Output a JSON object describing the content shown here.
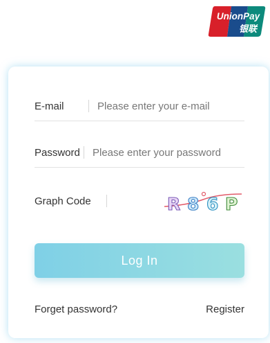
{
  "brand": {
    "logo_icon": "unionpay-logo-icon",
    "logo_text_en": "UnionPay",
    "logo_text_cn": "银联",
    "colors": {
      "red": "#d8202a",
      "blue": "#1a4c8c",
      "green": "#0d8a7c"
    }
  },
  "form": {
    "email_label": "E-mail",
    "email_placeholder": "Please enter your e-mail",
    "password_label": "Password",
    "password_placeholder": "Please enter your password",
    "graph_code_label": "Graph Code",
    "captcha_text": "R86P",
    "login_label": "Log In",
    "forget_label": "Forget password?",
    "register_label": "Register"
  },
  "colors": {
    "accent_gradient_start": "#7fd0e6",
    "accent_gradient_end": "#9adfe0",
    "card_glow": "#78c8eb"
  }
}
